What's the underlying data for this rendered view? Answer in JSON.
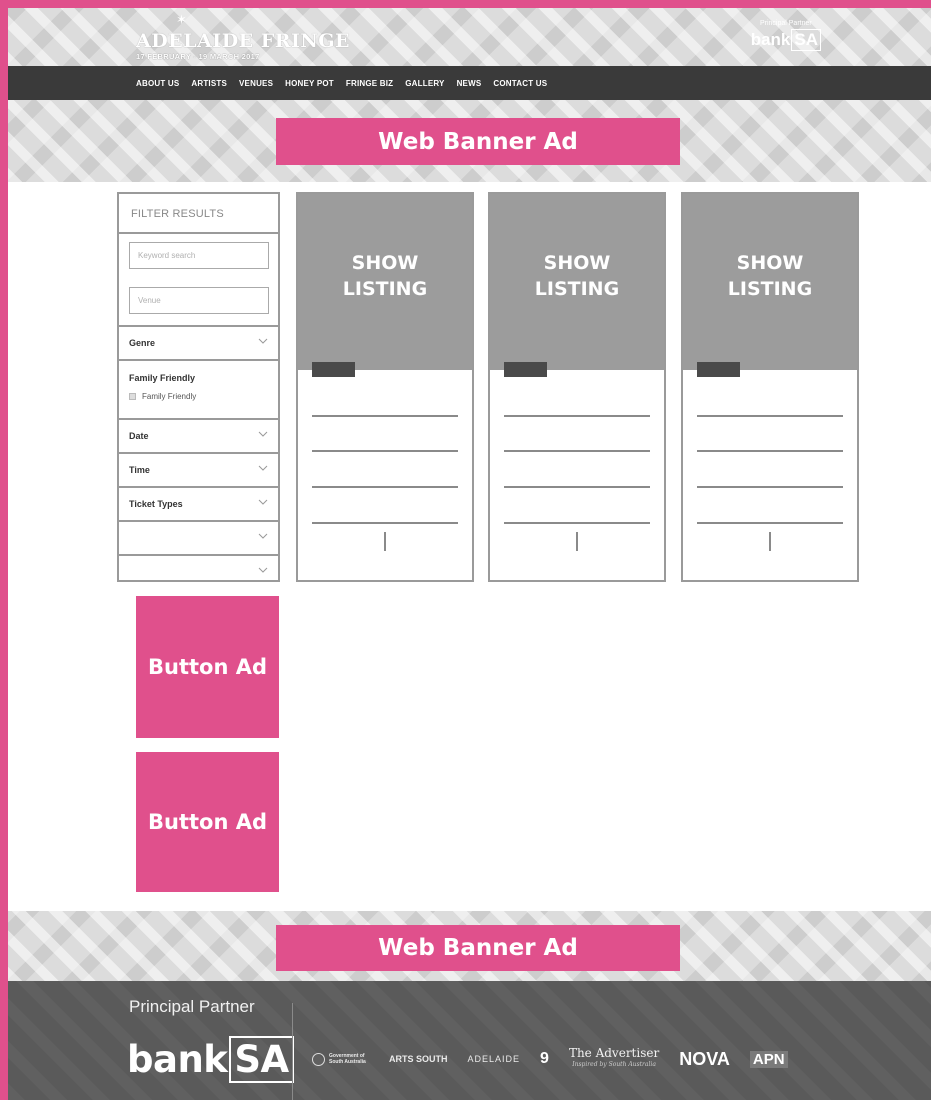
{
  "header": {
    "logo_name": "ADELAIDE FRINGE",
    "logo_dates": "17 FEBRUARY - 19 MARCH 2017",
    "partner_label": "Principal Partner",
    "partner_bank": "bank",
    "partner_sa": "SA"
  },
  "nav": {
    "items": [
      "ABOUT US",
      "ARTISTS",
      "VENUES",
      "HONEY POT",
      "FRINGE BIZ",
      "GALLERY",
      "NEWS",
      "CONTACT US"
    ]
  },
  "ads": {
    "top_banner": "Web Banner Ad",
    "button_ad_1": "Button Ad",
    "button_ad_2": "Button Ad",
    "bottom_banner": "Web Banner Ad"
  },
  "filter": {
    "title": "FILTER RESULTS",
    "keyword_placeholder": "Keyword search",
    "venue_placeholder": "Venue",
    "genre": "Genre",
    "family_title": "Family Friendly",
    "family_option": "Family Friendly",
    "date": "Date",
    "time": "Time",
    "ticket_types": "Ticket Types"
  },
  "cards": [
    {
      "title": "SHOW LISTING"
    },
    {
      "title": "SHOW LISTING"
    },
    {
      "title": "SHOW LISTING"
    }
  ],
  "footer": {
    "partner_label": "Principal Partner",
    "bank": "bank",
    "sa": "SA",
    "sponsors": {
      "gov": "Government of South Australia",
      "arts": "ARTS SOUTH",
      "adelaide": "ADELAIDE",
      "nine": "9",
      "advertiser": "The Advertiser",
      "advertiser_tag": "Inspired by South Australia",
      "nova": "NOVA",
      "apn": "APN"
    }
  },
  "colors": {
    "accent_pink": "#e0508c",
    "nav_dark": "#3a3a3a",
    "card_gray": "#9c9c9c",
    "footer_gray": "#5a5a5a"
  }
}
